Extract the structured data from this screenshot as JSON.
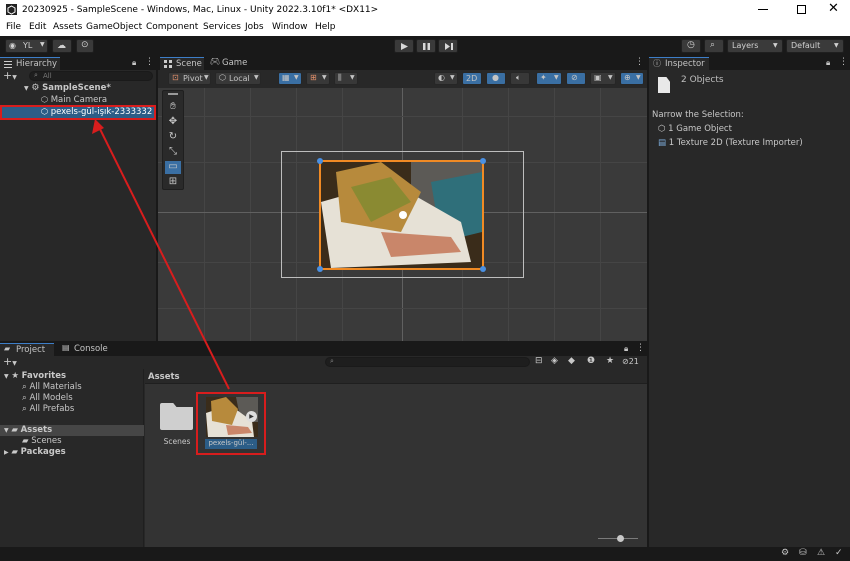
{
  "window": {
    "title": "20230925 - SampleScene - Windows, Mac, Linux - Unity 2022.3.10f1* <DX11>"
  },
  "menu": [
    "File",
    "Edit",
    "Assets",
    "GameObject",
    "Component",
    "Services",
    "Jobs",
    "Window",
    "Help"
  ],
  "toolbar": {
    "account": "YL",
    "layers": "Layers",
    "layout": "Default"
  },
  "hierarchy": {
    "tab": "Hierarchy",
    "search_placeholder": "All",
    "scene": "SampleScene*",
    "items": [
      "Main Camera",
      "pexels-gül-işık-2333332"
    ]
  },
  "scene": {
    "tabs": [
      "Scene",
      "Game"
    ],
    "pivot": "Pivot",
    "local": "Local",
    "mode_2d": "2D"
  },
  "project": {
    "tabs": [
      "Project",
      "Console"
    ],
    "favorites": "Favorites",
    "favorite_items": [
      "All Materials",
      "All Models",
      "All Prefabs"
    ],
    "assets": "Assets",
    "asset_children": [
      "Scenes"
    ],
    "packages": "Packages",
    "breadcrumb": "Assets",
    "hidden_count": "21",
    "grid_items": [
      "Scenes",
      "pexels-gül-..."
    ]
  },
  "inspector": {
    "tab": "Inspector",
    "count": "2 Objects",
    "narrow_label": "Narrow the Selection:",
    "items": [
      "1 Game Object",
      "1 Texture 2D (Texture Importer)"
    ]
  },
  "colors": {
    "highlight": "#d81d1d",
    "selection": "#2c5d87",
    "accent": "#3d7ec8"
  }
}
